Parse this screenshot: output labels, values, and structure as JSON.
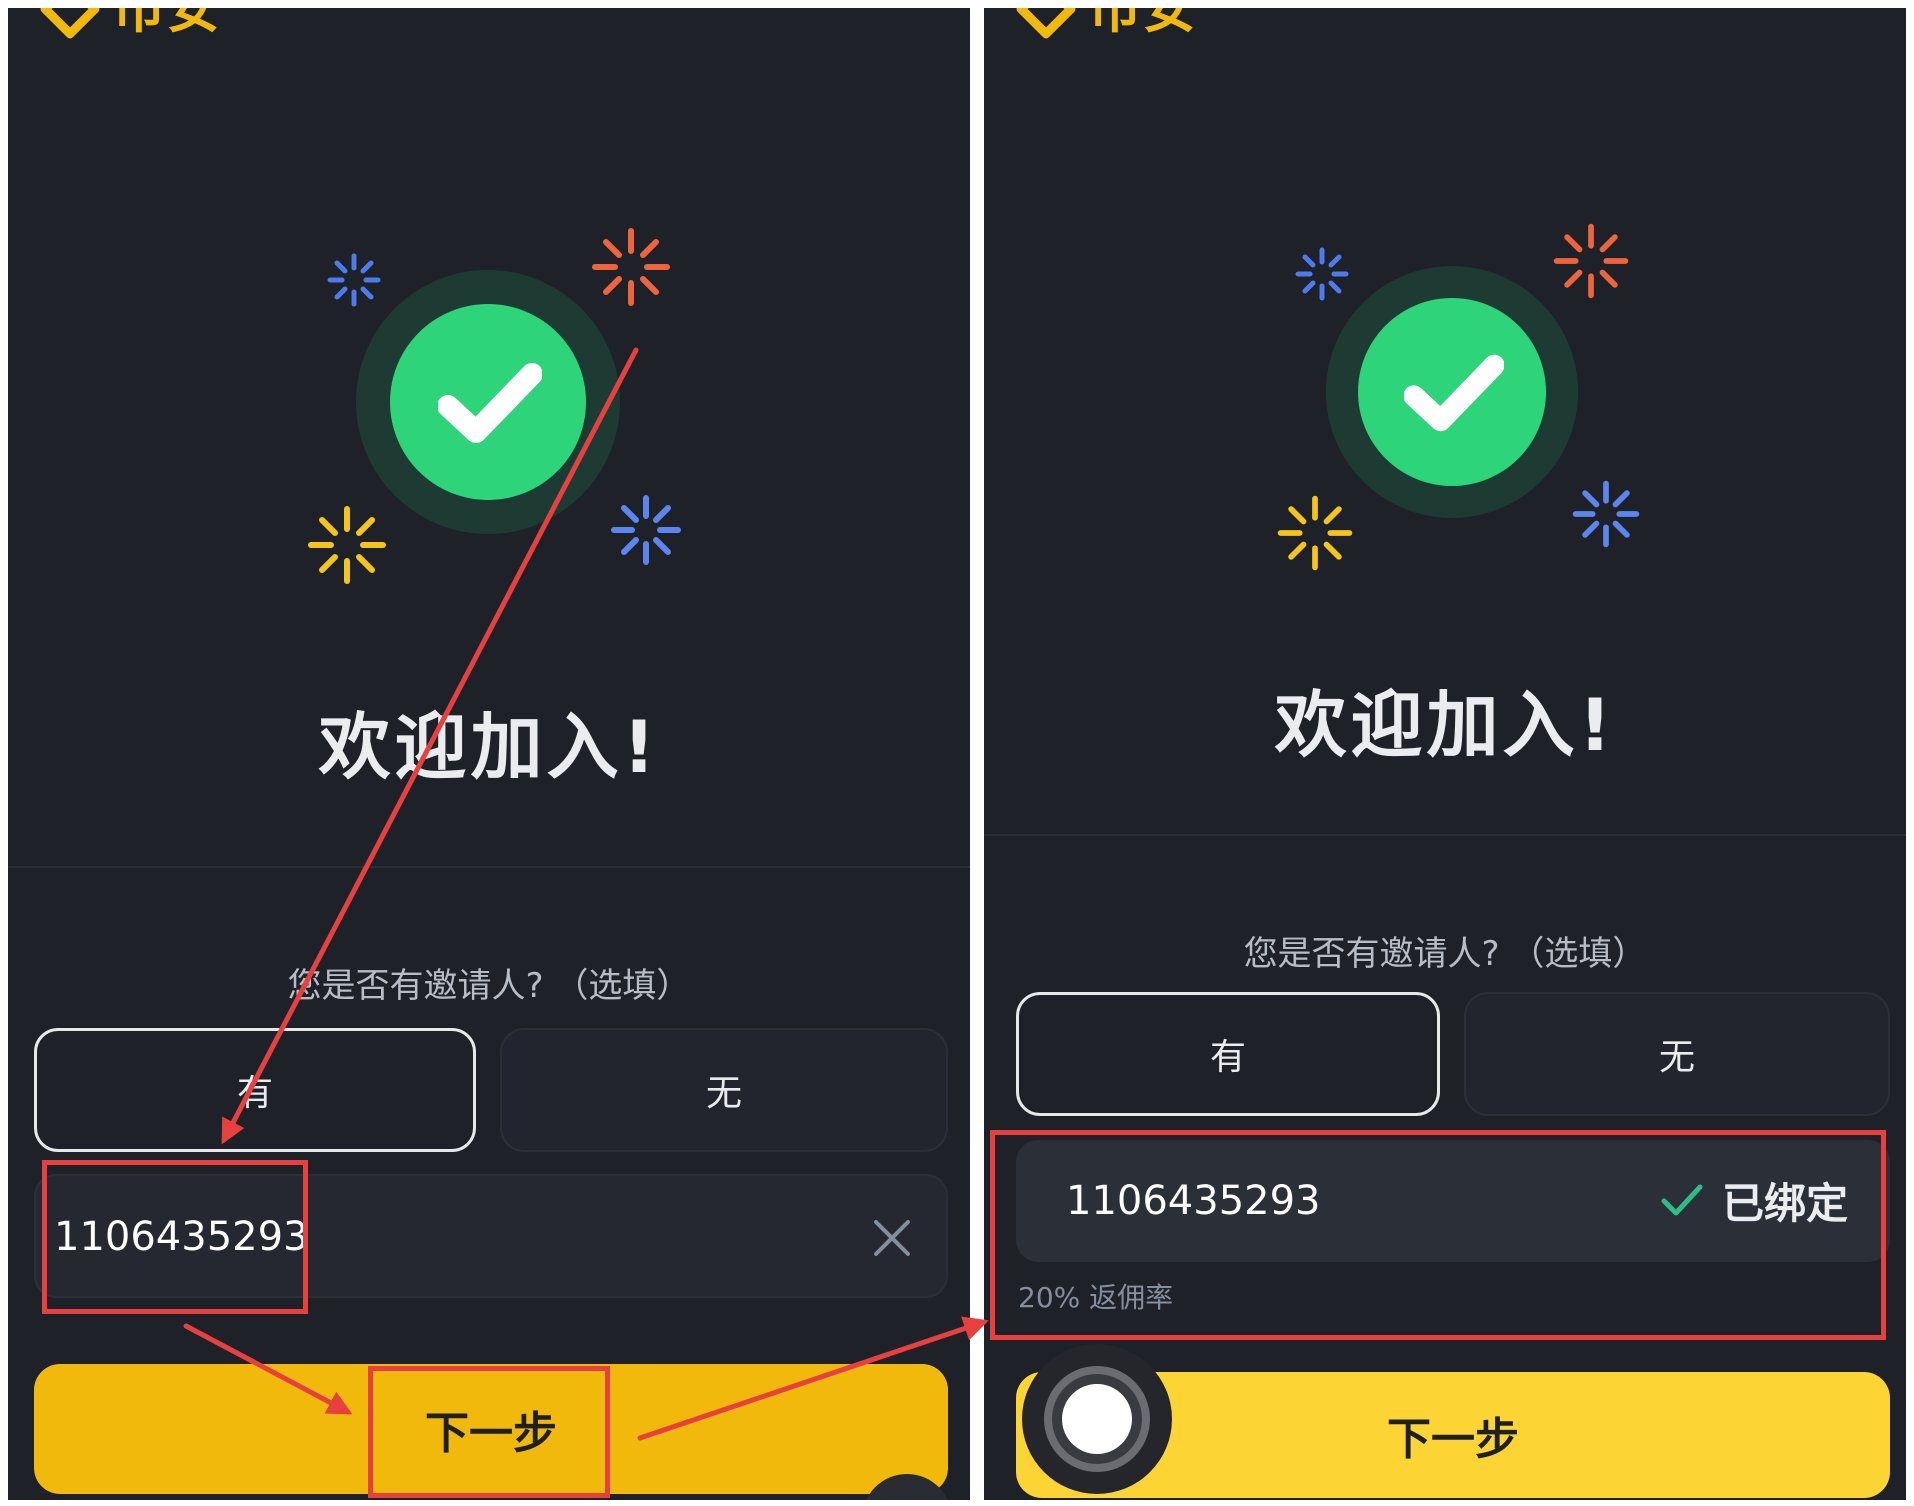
{
  "brand": {
    "name": "币安"
  },
  "left_screen": {
    "welcome_title": "欢迎加入!",
    "question": "您是否有邀请人? （选填）",
    "option_yes": "有",
    "option_no": "无",
    "referral_code": "1106435293",
    "next_label": "下一步"
  },
  "right_screen": {
    "welcome_title": "欢迎加入!",
    "question": "您是否有邀请人? （选填）",
    "option_yes": "有",
    "option_no": "无",
    "referral_code": "1106435293",
    "bound_status": "已绑定",
    "rebate_text": "20% 返佣率",
    "next_label": "下一步"
  },
  "colors": {
    "background": "#1f2129",
    "accent_yellow": "#f0b90b",
    "success_green": "#2ed47a",
    "annotation_red": "#e8403f",
    "burst_blue": "#4b7bec",
    "burst_orange": "#f0643c",
    "burst_yellow": "#f5c518"
  },
  "icons": {
    "success": "check-circle-icon",
    "clear": "close-icon",
    "bound": "check-icon",
    "brand": "binance-diamond-icon"
  }
}
